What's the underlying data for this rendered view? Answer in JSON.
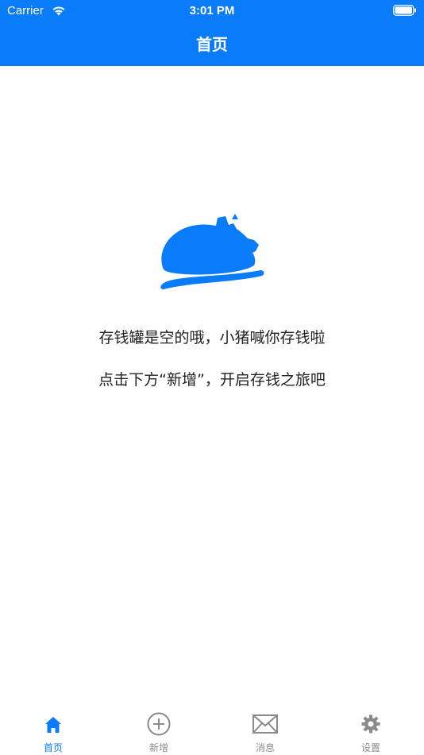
{
  "status_bar": {
    "carrier": "Carrier",
    "time": "3:01 PM",
    "wifi_icon": "wifi-icon",
    "battery_icon": "battery-full-icon"
  },
  "header": {
    "title": "首页",
    "background": "#0a7cf9"
  },
  "empty_state": {
    "icon": "piggy-bank-icon",
    "line1": "存钱罐是空的哦，小猪喊你存钱啦",
    "line2": "点击下方“新增”，开启存钱之旅吧"
  },
  "tabbar": {
    "active_color": "#0a7cf9",
    "inactive_color": "#8a8a8a",
    "tabs": [
      {
        "label": "首页",
        "icon": "home-icon",
        "active": true
      },
      {
        "label": "新增",
        "icon": "plus-circle-icon",
        "active": false
      },
      {
        "label": "消息",
        "icon": "mail-icon",
        "active": false
      },
      {
        "label": "设置",
        "icon": "gear-icon",
        "active": false
      }
    ]
  }
}
